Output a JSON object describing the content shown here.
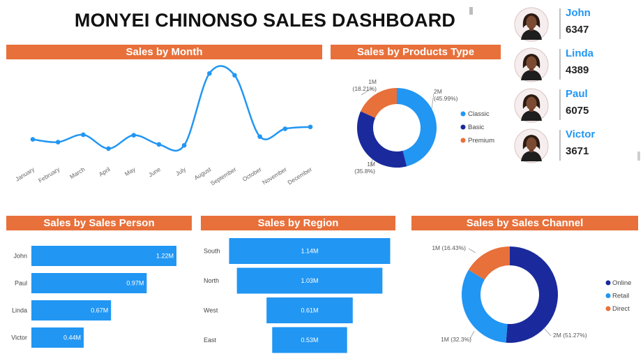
{
  "dashboard": {
    "title": "MONYEI CHINONSO SALES DASHBOARD"
  },
  "colors": {
    "banner": "#e8703a",
    "accent": "#2196f3",
    "navy": "#1a2a9c",
    "orange": "#e8703a"
  },
  "people": [
    {
      "name": "John",
      "value": "6347"
    },
    {
      "name": "Linda",
      "value": "4389"
    },
    {
      "name": "Paul",
      "value": "6075"
    },
    {
      "name": "Victor",
      "value": "3671"
    }
  ],
  "chart_data": [
    {
      "id": "sales_by_month",
      "type": "line",
      "title": "Sales by Month",
      "categories": [
        "January",
        "February",
        "March",
        "April",
        "May",
        "June",
        "July",
        "August",
        "September",
        "October",
        "November",
        "December"
      ],
      "values": [
        0.97,
        0.91,
        1.07,
        0.77,
        1.06,
        0.86,
        0.84,
        2.4,
        2.36,
        1.03,
        1.2,
        1.24
      ],
      "ylim": [
        0.6,
        2.6
      ]
    },
    {
      "id": "sales_by_product_type",
      "type": "pie",
      "donut": true,
      "title": "Sales by Products Type",
      "slices": [
        {
          "label": "Classic",
          "value": 45.99,
          "display": "2M",
          "pct": "(45.99%)",
          "color": "#2196f3"
        },
        {
          "label": "Basic",
          "value": 35.8,
          "display": "1M",
          "pct": "(35.8%)",
          "color": "#1a2a9c"
        },
        {
          "label": "Premium",
          "value": 18.21,
          "display": "1M",
          "pct": "(18.21%)",
          "color": "#e8703a"
        }
      ],
      "legend_position": "right"
    },
    {
      "id": "sales_by_sales_person",
      "type": "bar",
      "orientation": "horizontal",
      "title": "Sales by Sales Person",
      "categories": [
        "John",
        "Paul",
        "Linda",
        "Victor"
      ],
      "values": [
        1.22,
        0.97,
        0.67,
        0.44
      ],
      "labels": [
        "1.22M",
        "0.97M",
        "0.67M",
        "0.44M"
      ]
    },
    {
      "id": "sales_by_region",
      "type": "bar",
      "orientation": "horizontal",
      "variant": "funnel",
      "title": "Sales by Region",
      "categories": [
        "South",
        "North",
        "West",
        "East"
      ],
      "values": [
        1.14,
        1.03,
        0.61,
        0.53
      ],
      "labels": [
        "1.14M",
        "1.03M",
        "0.61M",
        "0.53M"
      ]
    },
    {
      "id": "sales_by_sales_channel",
      "type": "pie",
      "donut": true,
      "title": "Sales by Sales Channel",
      "slices": [
        {
          "label": "Online",
          "value": 51.27,
          "display": "2M",
          "pct": "(51.27%)",
          "color": "#1a2a9c"
        },
        {
          "label": "Retail",
          "value": 32.3,
          "display": "1M",
          "pct": "(32.3%)",
          "color": "#2196f3"
        },
        {
          "label": "Direct",
          "value": 16.43,
          "display": "1M",
          "pct": "(16.43%)",
          "color": "#e8703a"
        }
      ],
      "legend_position": "right"
    }
  ]
}
